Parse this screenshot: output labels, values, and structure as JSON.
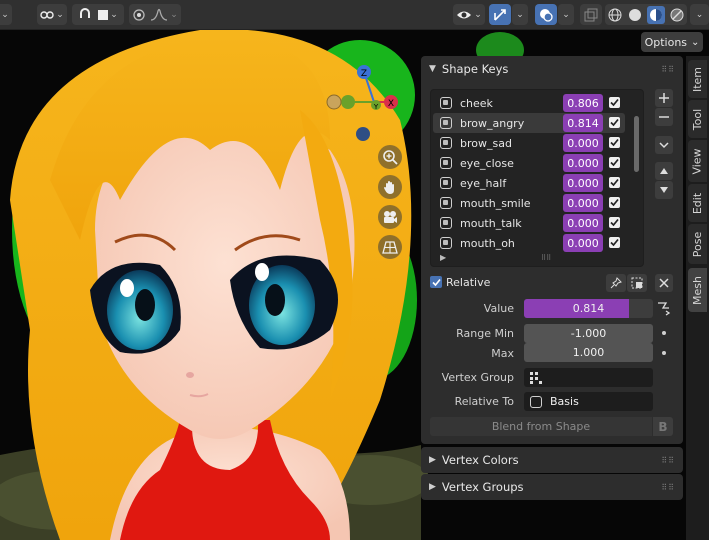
{
  "header": {
    "options_label": "Options",
    "options_chevron": "⌄"
  },
  "shape_keys": {
    "title": "Shape Keys",
    "items": [
      {
        "name": "cheek",
        "value": "0.806"
      },
      {
        "name": "brow_angry",
        "value": "0.814"
      },
      {
        "name": "brow_sad",
        "value": "0.000"
      },
      {
        "name": "eye_close",
        "value": "0.000"
      },
      {
        "name": "eye_half",
        "value": "0.000"
      },
      {
        "name": "mouth_smile",
        "value": "0.000"
      },
      {
        "name": "mouth_talk",
        "value": "0.000"
      },
      {
        "name": "mouth_oh",
        "value": "0.000"
      }
    ],
    "selected_index": 1,
    "relative_label": "Relative",
    "value_label": "Value",
    "value": "0.814",
    "value_fraction": 0.814,
    "range_min_label": "Range Min",
    "range_min": "-1.000",
    "max_label": "Max",
    "max": "1.000",
    "vertex_group_label": "Vertex Group",
    "vertex_group_value": "",
    "relative_to_label": "Relative To",
    "relative_to_value": "Basis",
    "blend_label": "Blend from Shape"
  },
  "collapsed_sections": {
    "vertex_colors": "Vertex Colors",
    "vertex_groups": "Vertex Groups"
  },
  "tabs": [
    "Item",
    "Tool",
    "View",
    "Edit",
    "Pose",
    "Mesh"
  ],
  "active_tab": "Mesh",
  "gizmo": {
    "z": "Z",
    "y": "Y",
    "x": "X"
  },
  "colors": {
    "value_field": "#8b3fb4",
    "active_button": "#4772b3",
    "panel_bg": "#2d2d2d",
    "header_bg": "#303030"
  }
}
